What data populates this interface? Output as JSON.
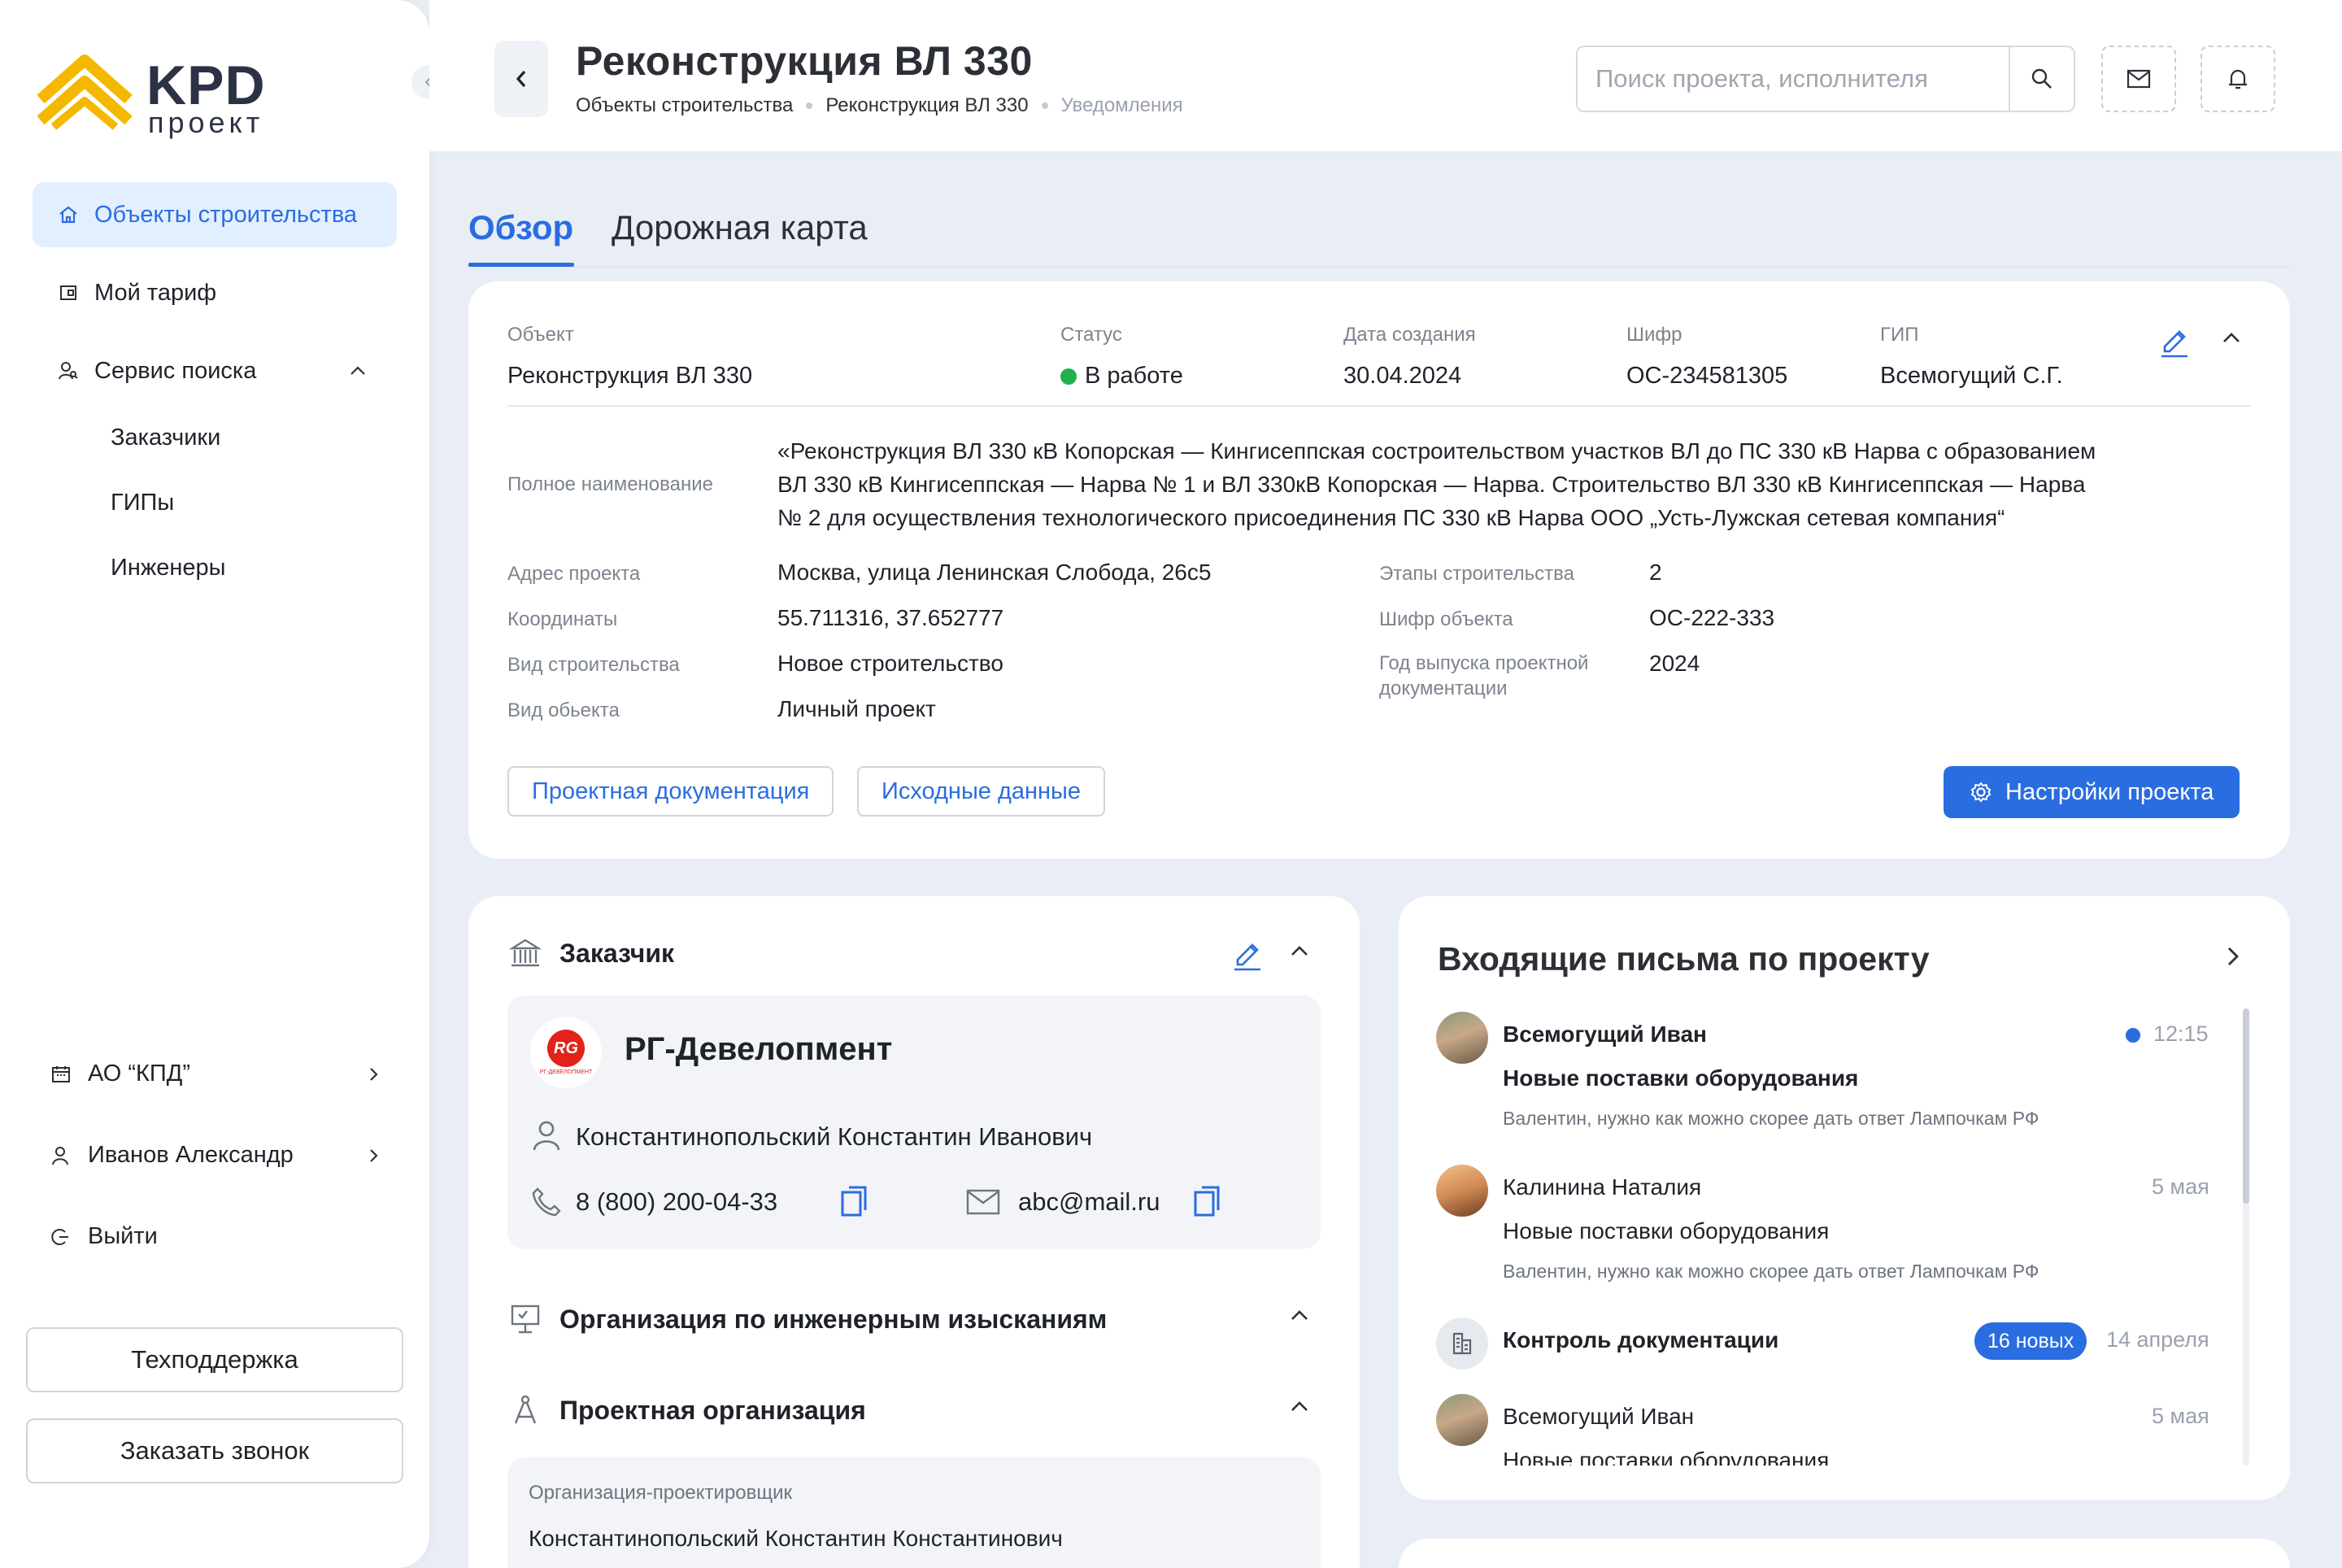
{
  "brand": {
    "logo_main": "KPD",
    "logo_sub": "проект",
    "accent_color": "#2a6de0",
    "logo_color": "#f5b800"
  },
  "sidebar": {
    "nav": [
      {
        "label": "Объекты строительства",
        "icon": "home-icon",
        "active": true
      },
      {
        "label": "Мой тариф",
        "icon": "wallet-icon"
      },
      {
        "label": "Сервис поиска",
        "icon": "people-search-icon"
      }
    ],
    "search_sub": [
      "Заказчики",
      "ГИПы",
      "Инженеры"
    ],
    "company": "АО “КПД”",
    "user": "Иванов Александр",
    "logout": "Выйти",
    "support_btn": "Техподдержка",
    "callback_btn": "Заказать звонок"
  },
  "header": {
    "title": "Реконструкция ВЛ 330",
    "breadcrumbs": [
      "Объекты строительства",
      "Реконструкция ВЛ 330",
      "Уведомления"
    ],
    "search_placeholder": "Поиск проекта, исполнителя"
  },
  "tabs": [
    "Обзор",
    "Дорожная карта"
  ],
  "overview": {
    "columns": [
      {
        "label": "Объект",
        "value": "Реконструкция ВЛ 330"
      },
      {
        "label": "Статус",
        "value": "В работе",
        "status_color": "#22b14c"
      },
      {
        "label": "Дата создания",
        "value": "30.04.2024"
      },
      {
        "label": "Шифр",
        "value": "ОС-234581305"
      },
      {
        "label": "ГИП",
        "value": "Всемогущий С.Г."
      }
    ],
    "full_name_label": "Полное наименование",
    "full_name_lines": [
      "«Реконструкция ВЛ 330 кВ Копорская — Кингисеппская состроительством участков ВЛ до ПС 330 кВ Нарва с образованием",
      "ВЛ 330 кВ Кингисеппская — Нарва № 1 и ВЛ 330кВ Копорская — Нарва. Строительство ВЛ 330 кВ Кингисеппская — Нарва",
      "№ 2 для осуществления технологического присоединения ПС 330 кВ Нарва ООО „Усть-Лужская сетевая компания“"
    ],
    "left_details": [
      {
        "label": "Адрес проекта",
        "value": "Москва, улица Ленинская Слобода, 26с5"
      },
      {
        "label": "Координаты",
        "value": "55.711316, 37.652777"
      },
      {
        "label": "Вид строительства",
        "value": "Новое строительство"
      },
      {
        "label": "Вид обьекта",
        "value": "Личный проект"
      }
    ],
    "right_details": [
      {
        "label": "Этапы строительства",
        "value": "2"
      },
      {
        "label": "Шифр объекта",
        "value": "ОС-222-333"
      },
      {
        "label_line1": "Год выпуска проектной",
        "label_line2": "документации",
        "value": "2024"
      }
    ],
    "btn_docs": "Проектная документация",
    "btn_source": "Исходные данные",
    "btn_settings": "Настройки проекта"
  },
  "customer": {
    "section_title": "Заказчик",
    "company_name": "РГ-Девелопмент",
    "logo_text": "RG",
    "logo_caption": "РГ-ДЕВЕЛОПМЕНТ",
    "contact_person": "Константинопольский Константин Иванович",
    "phone": "8 (800) 200-04-33",
    "email": "abc@mail.ru",
    "survey_org_title": "Организация по инженерным изысканиям",
    "design_org_title": "Проектная организация",
    "designer_label": "Организация-проектировщик",
    "designer_value": "Константинопольский Константин Константинович"
  },
  "mail": {
    "title": "Входящие письма по проекту",
    "items": [
      {
        "name": "Всемогущий Иван",
        "subject": "Новые поставки оборудования",
        "preview": "Валентин, нужно как можно скорее дать ответ Лампочкам РФ",
        "time": "12:15",
        "unread": true
      },
      {
        "name": "Калинина Наталия",
        "subject": "Новые поставки оборудования",
        "preview": "Валентин, нужно как можно скорее дать ответ Лампочкам РФ",
        "time": "5 мая",
        "unread": false
      },
      {
        "name": "Контроль документации",
        "badge": "16 новых",
        "time": "14 апреля",
        "unread": true
      },
      {
        "name": "Всемогущий Иван",
        "subject": "Новые поставки оборудования",
        "time": "5 мая",
        "unread": false
      }
    ]
  }
}
